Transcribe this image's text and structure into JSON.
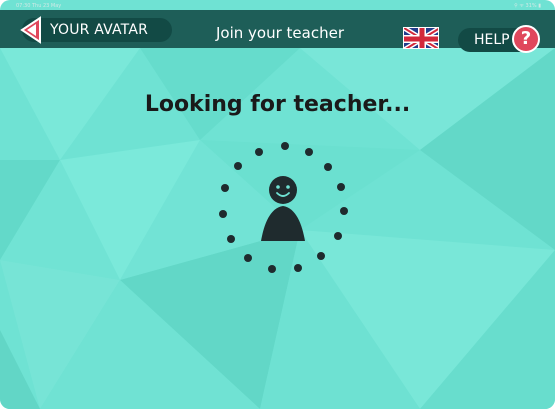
{
  "status_bar": {
    "time": "07:30  Thu 23 May",
    "indicators": "⚲ ᯤ 31% ▮"
  },
  "header": {
    "back_label": "YOUR AVATAR",
    "title": "Join your teacher",
    "help_label": "HELP",
    "help_symbol": "?",
    "language_flag": "uk-flag-icon"
  },
  "main": {
    "message": "Looking for teacher..."
  },
  "icons": {
    "back": "chevron-left-icon",
    "help": "question-mark-icon",
    "spinner": "loading-dots-icon",
    "avatar": "person-icon"
  },
  "colors": {
    "background": "#6fe2d3",
    "topbar": "#1e5e58",
    "button": "#124a45",
    "back_arrow": "#e0475c",
    "help_circle": "#e0475c",
    "text": "#1a1a1a"
  }
}
